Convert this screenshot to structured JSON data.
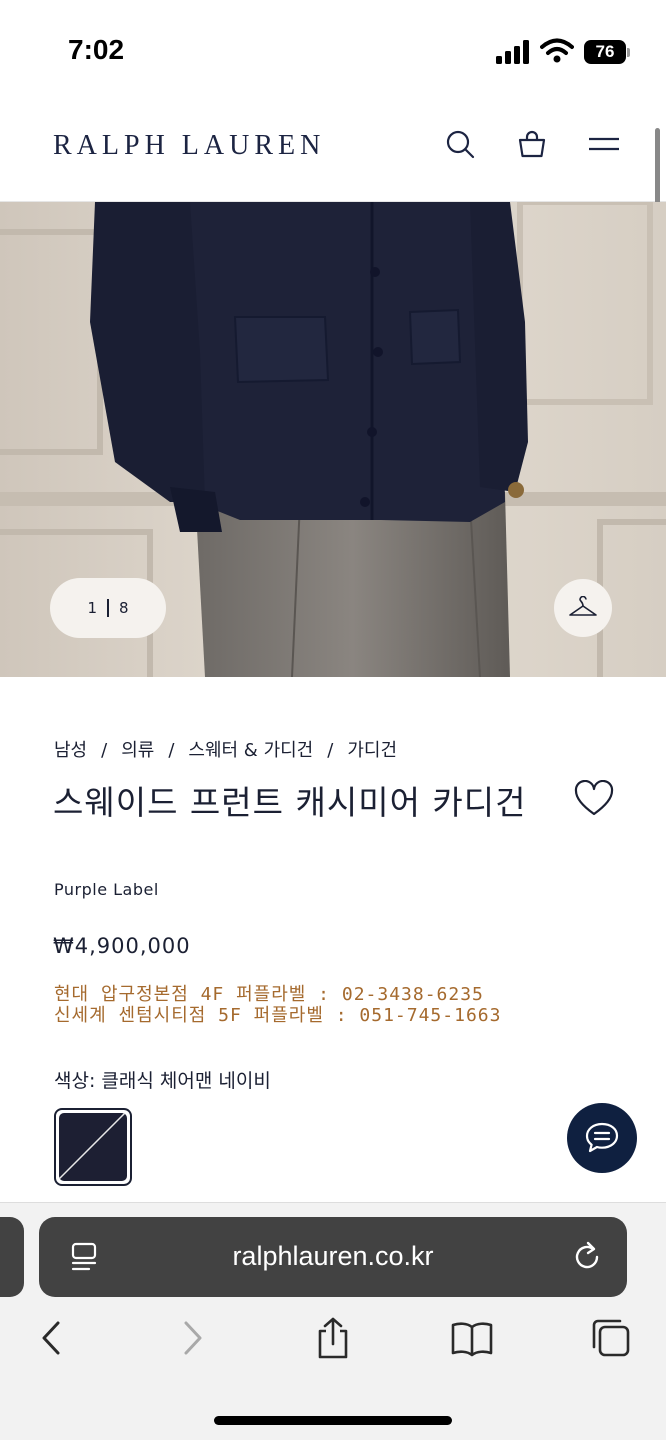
{
  "status_bar": {
    "time": "7:02",
    "battery": "76",
    "icons": [
      "signal-icon",
      "wifi-icon",
      "battery-icon"
    ]
  },
  "header": {
    "logo": "RALPH LAUREN",
    "icons": [
      "search-icon",
      "shopping-bag-icon",
      "menu-icon"
    ]
  },
  "gallery": {
    "current": "1",
    "total": "8",
    "icons": [
      "hanger-icon"
    ]
  },
  "breadcrumb": [
    "남성",
    "의류",
    "스웨터 & 가디건",
    "가디건"
  ],
  "breadcrumb_separator": "/",
  "product": {
    "title": "스웨이드 프런트 캐시미어 카디건",
    "brand": "Purple Label",
    "price": "₩4,900,000"
  },
  "store_info": [
    "현대 압구정본점 4F 퍼플라벨 : 02-3438-6235",
    "신세계 센텀시티점 5F 퍼플라벨 : 051-745-1663"
  ],
  "color": {
    "label": "색상: 클래식 체어맨 네이비",
    "swatch_color": "#1d1f33"
  },
  "browser": {
    "url": "ralphlauren.co.kr",
    "icons": [
      "reader-icon",
      "reload-icon",
      "back-icon",
      "forward-icon",
      "share-icon",
      "bookmarks-icon",
      "tabs-icon"
    ]
  },
  "colors": {
    "navy": "#1b2033",
    "store_text": "#a56a2e",
    "chat_button": "#0f2040"
  }
}
